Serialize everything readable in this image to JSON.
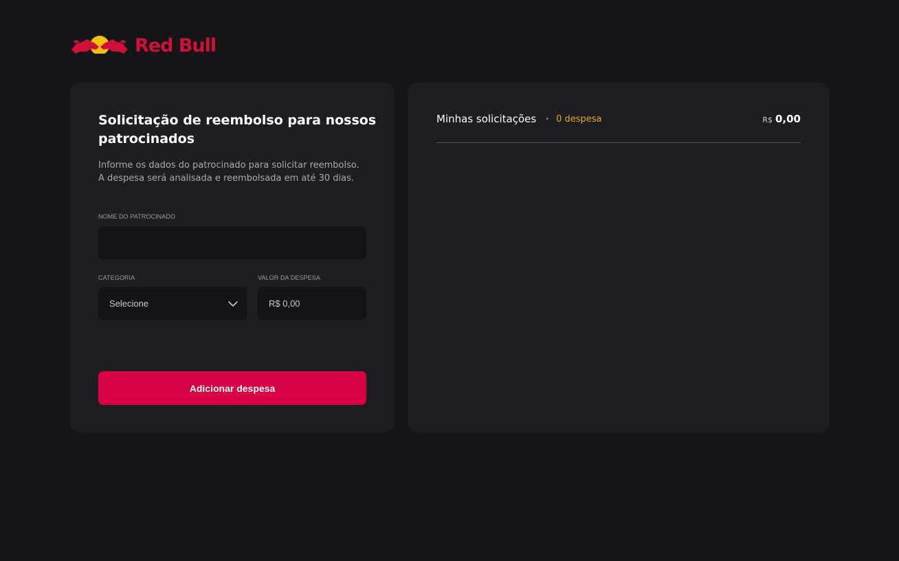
{
  "brand": {
    "logo_text": "Red Bull",
    "logo_icon": "red-bull-charging-bulls-logo",
    "color": "#d0103a"
  },
  "form": {
    "title": "Solicitação de reembolso para nossos patrocinados",
    "description_line1": "Informe os dados do patrocinado para solicitar reembolso.",
    "description_line2": "A despesa será analisada e reembolsada em até 30 dias.",
    "nome_label": "NOME DO PATROCINADO",
    "nome_value": "",
    "categoria_label": "CATEGORIA",
    "categoria_selected": "Selecione",
    "valor_label": "VALOR DA DESPESA",
    "valor_placeholder": "R$ 0,00",
    "submit_label": "Adicionar despesa"
  },
  "requests": {
    "title": "Minhas solicitações",
    "separator": "•",
    "count_label": "0 despesa",
    "total_currency": "R$",
    "total_amount": "0,00"
  },
  "colors": {
    "background": "#151518",
    "card": "#1e1e22",
    "accent_button": "#d70040",
    "count_highlight": "#e5a91a"
  }
}
